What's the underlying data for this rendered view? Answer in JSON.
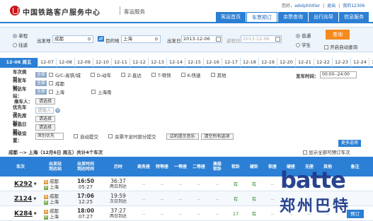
{
  "header": {
    "site_title": "中国铁路客户服务中心",
    "site_sub": "客运服务",
    "user": {
      "greeting": "您好，",
      "username": "adolphhitler",
      "logout": "退出",
      "service": "我的12306"
    },
    "nav": [
      "客运首页",
      "车票预订",
      "余票查询",
      "出行向导",
      "信息服务"
    ],
    "nav_active": 1
  },
  "search": {
    "trip_single": "单程",
    "trip_round": "往返",
    "from_label": "出发地",
    "from_value": "成都",
    "to_label": "目的地",
    "to_value": "上海",
    "depart_label": "出发日",
    "depart_value": "2013-12-06",
    "return_label": "返程日",
    "return_value": "2013-12-06",
    "type_normal": "普通",
    "type_student": "学生",
    "query_button": "查询",
    "auto_query": "开启自动查询"
  },
  "dates": [
    "12-06 周五",
    "12-07",
    "12-08",
    "12-09",
    "12-10",
    "12-11",
    "12-12",
    "12-13",
    "12-14",
    "12-15",
    "12-16",
    "12-17",
    "12-18",
    "12-19",
    "12-20",
    "12-21",
    "12-22",
    "12-23",
    "12-24",
    "12-25"
  ],
  "filters": {
    "train_type_label": "车次类型：",
    "all_tag": "全部",
    "train_types": [
      "G/C-高铁/城",
      "D-动车",
      "Z-直达",
      "T-特快",
      "K-快速",
      "其他"
    ],
    "depart_time_label": "发车时间：",
    "depart_time_value": "00:00--24:00",
    "from_station_label": "出发车站：",
    "from_stations": [
      "成都"
    ],
    "to_station_label": "到达车站：",
    "to_stations": [
      "上海",
      "上海南"
    ],
    "passenger_label": "乘车人：",
    "select_btn": "请选择",
    "priority_train_label": "优先车次：",
    "priority_train_ph": "请输入",
    "priority_seat_label": "优先席别：",
    "backup_date_label": "备选日期：",
    "advanced_label": "高级设置：",
    "advanced_value": "席别优先",
    "auto_submit": "自动提交",
    "partial_submit": "余票不足时部分提交",
    "test_music": "试听提示音乐",
    "clear_all": "清空所有选项",
    "more": "更多选项"
  },
  "result": {
    "route": "成都 --> 上海（12月6日 周五）共计4个车次",
    "show_all": "显示全部可预订车次"
  },
  "table": {
    "headers": [
      "车次",
      "出发站\n到达站",
      "出发时间\n到达时间",
      "历时",
      "商务座",
      "特等座",
      "一等座",
      "二等座",
      "高级\n软卧",
      "软卧",
      "硬卧",
      "软座",
      "硬座",
      "无座",
      "其他",
      "备注"
    ],
    "rows": [
      {
        "train": "K292",
        "from": "成都",
        "to": "上海",
        "dep": "16:50",
        "arr": "05:27",
        "dur": "36:37",
        "day": "两日到达",
        "soft_sleeper": "有",
        "hard_sleeper": "有"
      },
      {
        "train": "Z124",
        "from": "成都",
        "to": "上海",
        "dep": "17:06",
        "arr": "12:25",
        "dur": "19:59",
        "day": "次日到达",
        "soft_sleeper": "有",
        "hard_sleeper": "有"
      },
      {
        "train": "K284",
        "from": "成都",
        "to": "上海",
        "dep": "18:00",
        "arr": "07:27",
        "dur": "37:27",
        "day": "两日到达",
        "soft_sleeper": "17",
        "hard_sleeper": "有",
        "book": "预订"
      }
    ]
  },
  "watermark": {
    "line1": "batte",
    "line2": "郑州巴特"
  },
  "colors": {
    "accent": "#2b7fd4",
    "orange": "#f58a1f",
    "brand_red": "#c8161d"
  }
}
